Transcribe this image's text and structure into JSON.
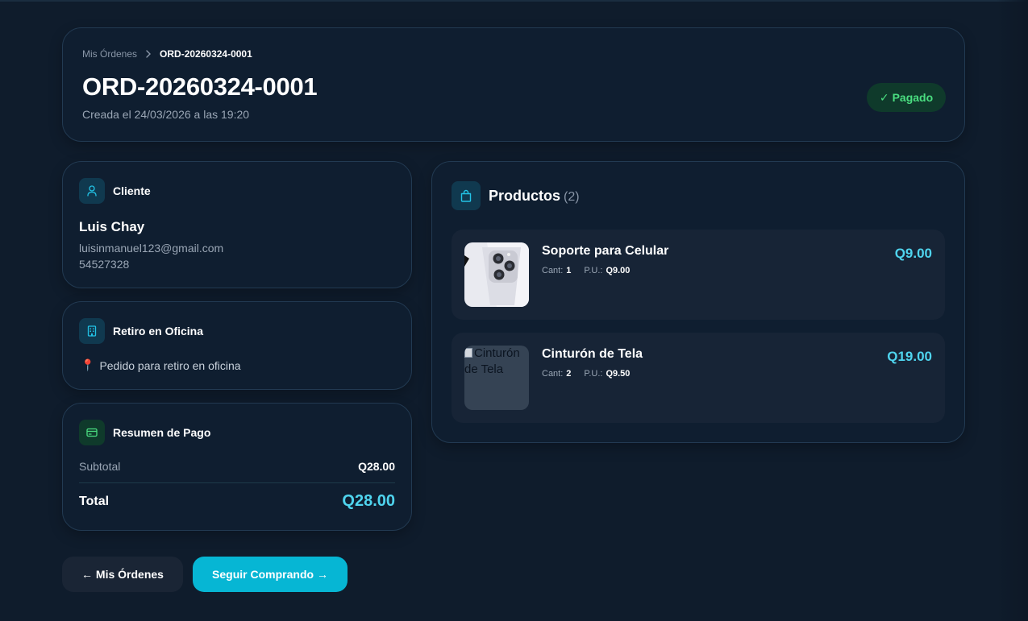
{
  "breadcrumb": {
    "parent": "Mis Órdenes",
    "current": "ORD-20260324-0001"
  },
  "order": {
    "id": "ORD-20260324-0001",
    "created": "Creada el 24/03/2026 a las 19:20",
    "status_icon": "✓",
    "status": "Pagado"
  },
  "client": {
    "title": "Cliente",
    "name": "Luis Chay",
    "email": "luisinmanuel123@gmail.com",
    "phone": "54527328"
  },
  "pickup": {
    "title": "Retiro en Oficina",
    "pin": "📍",
    "text": "Pedido para retiro en oficina"
  },
  "summary": {
    "title": "Resumen de Pago",
    "subtotal_label": "Subtotal",
    "subtotal_value": "Q28.00",
    "total_label": "Total",
    "total_value": "Q28.00"
  },
  "products": {
    "title": "Productos",
    "count": "(2)",
    "items": [
      {
        "name": "Soporte para Celular",
        "qty_label": "Cant:",
        "qty": "1",
        "unit_label": "P.U.:",
        "unit_price": "Q9.00",
        "price": "Q9.00",
        "image": "phone-photo"
      },
      {
        "name": "Cinturón de Tela",
        "qty_label": "Cant:",
        "qty": "2",
        "unit_label": "P.U.:",
        "unit_price": "Q9.50",
        "price": "Q19.00",
        "image_alt": "Cinturón de Tela"
      }
    ]
  },
  "actions": {
    "back": "← Mis Órdenes",
    "continue": "Seguir Comprando →"
  },
  "colors": {
    "background": "#0f1c2c",
    "accent": "#4fd4ee",
    "button_primary": "#06b6d4",
    "success": "#4ade80"
  }
}
